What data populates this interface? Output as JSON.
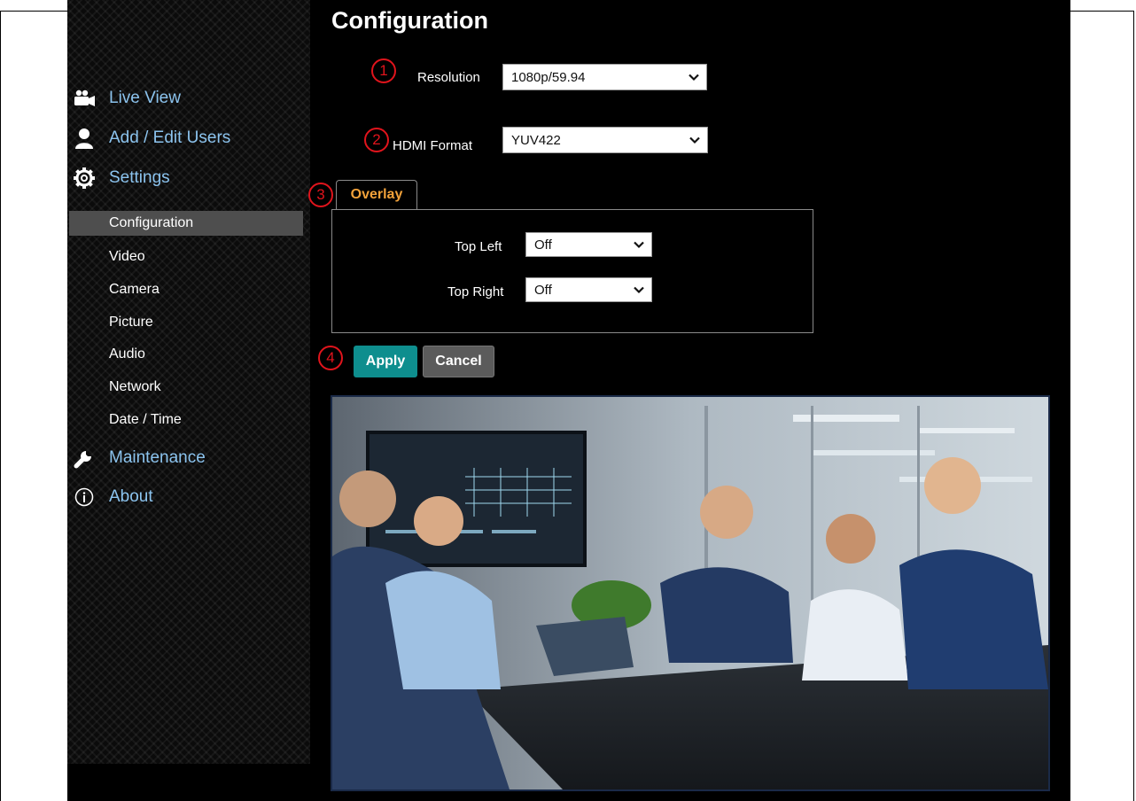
{
  "page": {
    "title": "Configuration"
  },
  "sidebar": {
    "main_items": [
      {
        "label": "Live View",
        "icon": "camera-icon"
      },
      {
        "label": "Add / Edit Users",
        "icon": "user-icon"
      },
      {
        "label": "Settings",
        "icon": "gear-icon"
      },
      {
        "label": "Maintenance",
        "icon": "wrench-icon"
      },
      {
        "label": "About",
        "icon": "info-icon"
      }
    ],
    "sub_items": [
      {
        "label": "Configuration",
        "active": true
      },
      {
        "label": "Video"
      },
      {
        "label": "Camera"
      },
      {
        "label": "Picture"
      },
      {
        "label": "Audio"
      },
      {
        "label": "Network"
      },
      {
        "label": "Date / Time"
      }
    ]
  },
  "markers": [
    "1",
    "2",
    "3",
    "4"
  ],
  "form": {
    "resolution": {
      "label": "Resolution",
      "value": "1080p/59.94"
    },
    "hdmi_format": {
      "label": "HDMI Format",
      "value": "YUV422"
    }
  },
  "overlay": {
    "tab_label": "Overlay",
    "top_left": {
      "label": "Top Left",
      "value": "Off"
    },
    "top_right": {
      "label": "Top Right",
      "value": "Off"
    }
  },
  "buttons": {
    "apply": "Apply",
    "cancel": "Cancel"
  },
  "colors": {
    "nav_link": "#8cc4ef",
    "tab_text": "#f2a23a",
    "apply_bg": "#0e8e8e",
    "cancel_bg": "#5b5b5b",
    "marker": "#e0141c"
  }
}
